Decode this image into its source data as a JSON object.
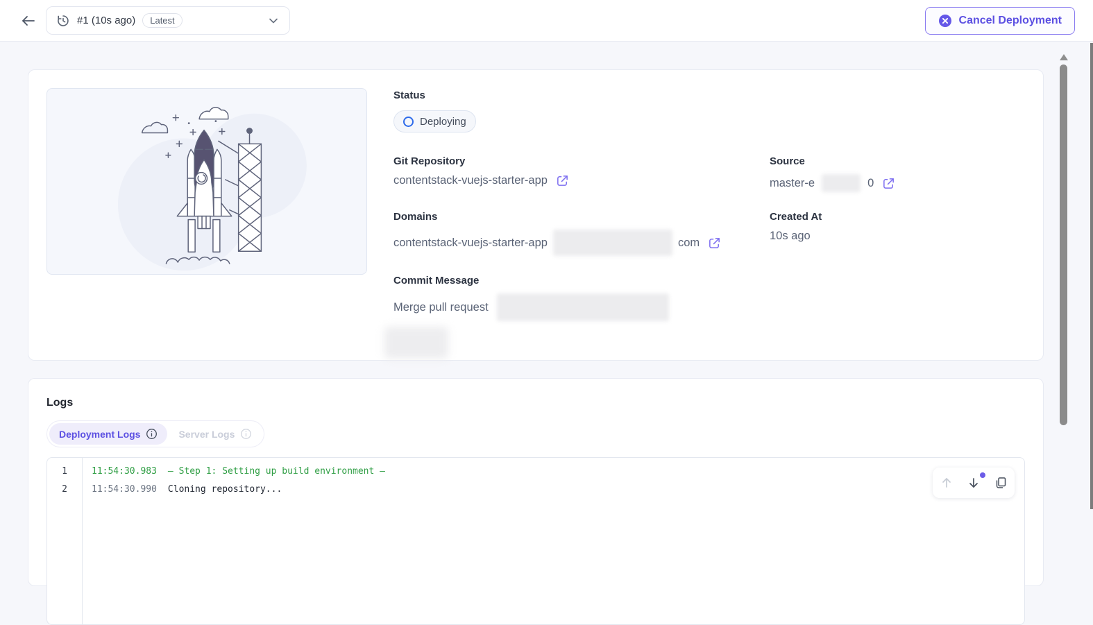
{
  "topbar": {
    "selector_label": "#1 (10s ago)",
    "selector_badge": "Latest",
    "cancel_label": "Cancel Deployment"
  },
  "overview": {
    "status_label": "Status",
    "status_value": "Deploying",
    "git_repository_label": "Git Repository",
    "git_repository_value": "contentstack-vuejs-starter-app",
    "source_label": "Source",
    "source_value_prefix": "master-e",
    "source_value_suffix": "0",
    "domains_label": "Domains",
    "domains_value_prefix": "contentstack-vuejs-starter-app",
    "domains_value_suffix": "com",
    "created_at_label": "Created At",
    "created_at_value": "10s ago",
    "commit_message_label": "Commit Message",
    "commit_message_value": "Merge pull request"
  },
  "logs": {
    "title": "Logs",
    "tabs": {
      "deployment_label": "Deployment Logs",
      "server_label": "Server Logs"
    },
    "entries": [
      {
        "line": "1",
        "time": "11:54:30.983",
        "message": "— Step 1: Setting up build environment —"
      },
      {
        "line": "2",
        "time": "11:54:30.990",
        "message": "Cloning repository..."
      }
    ]
  },
  "colors": {
    "accent_purple": "#5c50e2",
    "status_blue": "#2e6bea",
    "log_step_green": "#2f9e44"
  }
}
